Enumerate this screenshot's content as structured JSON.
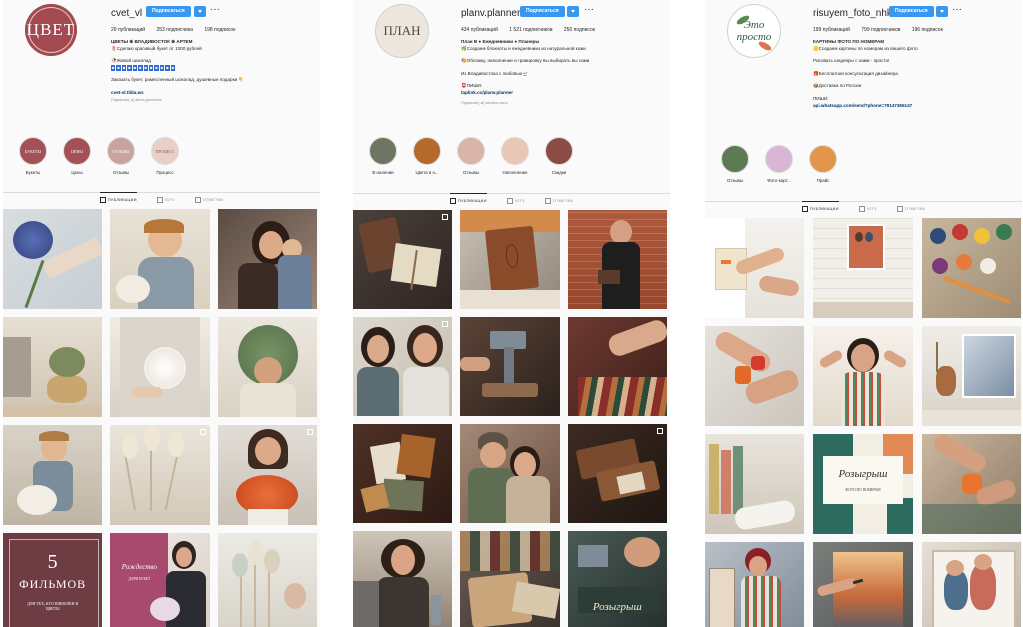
{
  "profiles": [
    {
      "avatar_text": "ЦВЕТ",
      "username": "cvet_vl",
      "follow_label": "Подписаться",
      "more_label": "···",
      "stats": {
        "posts": "29 публикаций",
        "followers": "253 подписчика",
        "following": "198 подписок"
      },
      "bio": {
        "line1": "ЦВЕТЫ ❀ ВЛАДИВОСТОК ❀ АРТЕМ",
        "line2": "🌷Сделаю красивый букет от 1000 рублей",
        "line3": "🥀Живой шоколад",
        "line4": "Заказать букет, рамесленный шоколад, душевные подарки 👇",
        "link": "cvet-vl.tilda.ws",
        "followed_by": "Подписан(-а) alena.ganzenko"
      },
      "highlights": [
        {
          "label": "Букеты",
          "text": "БУКЕТЫ",
          "color": "#a35157"
        },
        {
          "label": "Цены",
          "text": "ЦЕНЫ",
          "color": "#a35157"
        },
        {
          "label": "Отзывы",
          "text": "ОТЗЫВЫ",
          "color": "#c9a39e"
        },
        {
          "label": "Процесс",
          "text": "ПРОЦЕСС",
          "color": "#e9cfc7"
        }
      ],
      "tabs": [
        "ПУБЛИКАЦИИ",
        "IGTV",
        "ОТМЕТКИ"
      ],
      "tile_texts": {
        "t10_big": "5",
        "t10_title": "ФИЛЬМОВ",
        "t10_sub": "ДЛЯ ТЕХ, КТО ВЛЮБЛЕН В ЦВЕТЫ",
        "t11_title": "Рождество",
        "t11_sub": "ДАРИ БУКЕТ"
      }
    },
    {
      "avatar_text": "ПЛАН",
      "username": "planv.planner",
      "follow_label": "Подписаться",
      "more_label": "···",
      "stats": {
        "posts": "434 публикаций",
        "followers": "1 521 подписчиков",
        "following": "250 подписок"
      },
      "bio": {
        "line1": "План В ● Ежедневники ● Планеры",
        "line2": "🌿Создаем блокноты и ежедневники из натуральной кожи",
        "line3": "🎨Обложку, наполнение и гравировку вы выбирать вы сами",
        "line4": "Из Владивостока с любовью🛫",
        "label": "📮ПИШИ:",
        "link": "taplink.cc/planv.planner",
        "followed_by": "Подписан(-а) sumikin.nana"
      },
      "highlights": [
        {
          "label": "В наличии",
          "text": "",
          "color": "#6f7563"
        },
        {
          "label": "Цвета в н...",
          "text": "",
          "color": "#b56a2c"
        },
        {
          "label": "Отзывы",
          "text": "",
          "color": "#d8b5a8"
        },
        {
          "label": "Наполнение",
          "text": "",
          "color": "#e8c7b6"
        },
        {
          "label": "Скидки",
          "text": "",
          "color": "#8a4c44"
        }
      ],
      "tabs": [
        "ПУБЛИКАЦИИ",
        "IGTV",
        "ОТМЕТКИ"
      ],
      "tile_texts": {
        "t12_title": "Розыгрыш"
      }
    },
    {
      "avatar_text": "Это просто",
      "username": "risuyem_foto_nhk",
      "follow_label": "Подписаться",
      "more_label": "···",
      "stats": {
        "posts": "199 публикаций",
        "followers": "799 подписчиков",
        "following": "196 подписок"
      },
      "bio": {
        "line1": "КАРТИНЫ ФОТО ПО НОМЕРАМ",
        "line2": "🟡Создаем картины по номерам из вашего фото",
        "line3": "Рисовать шедевры с нами - просто!",
        "line4": "🎁Бесплатная консультация дизайнера",
        "line5": "📦Доставка по России",
        "label": "ПИШИ:",
        "link": "api.whatsapp.com/send?phone=79147355147"
      },
      "highlights": [
        {
          "label": "Отзывы",
          "text": "",
          "color": "#5c7a54"
        },
        {
          "label": "Фото-карт...",
          "text": "",
          "color": "#d9b6d5"
        },
        {
          "label": "Прайс",
          "text": "",
          "color": "#e3954a"
        }
      ],
      "tabs": [
        "ПУБЛИКАЦИИ",
        "IGTV",
        "ОТМЕТКИ"
      ],
      "tile_texts": {
        "t5_title": "Розыгрыш",
        "t5_sub": "ФОТО ПО НОМЕРАМ"
      }
    }
  ],
  "colors": {
    "follow_blue": "#3897f0",
    "brand_red": "#a24a4f",
    "link": "#00376b"
  }
}
